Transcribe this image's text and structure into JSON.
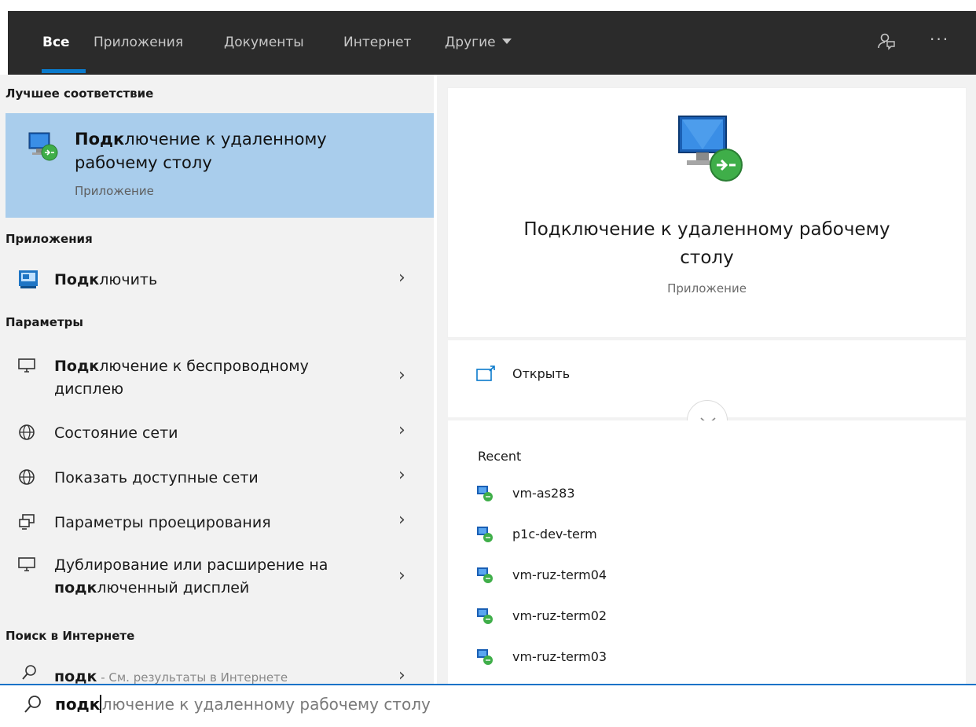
{
  "tabs": {
    "all": "Все",
    "apps": "Приложения",
    "docs": "Документы",
    "web": "Интернет",
    "other": "Другие"
  },
  "left": {
    "best_match_title": "Лучшее соответствие",
    "best_match": {
      "title_bold": "Подк",
      "title_rest_line1": "лючение к удаленному",
      "title_line2": "рабочему столу",
      "subtitle": "Приложение"
    },
    "apps_title": "Приложения",
    "apps": [
      {
        "bold": "Подк",
        "rest": "лючить"
      }
    ],
    "settings_title": "Параметры",
    "settings": [
      {
        "bold": "Подк",
        "rest": "лючение к беспроводному",
        "line2": "дисплею"
      },
      {
        "label": "Состояние сети"
      },
      {
        "label": "Показать доступные сети"
      },
      {
        "label": "Параметры проецирования"
      },
      {
        "line1": "Дублирование или расширение на",
        "bold2": "подк",
        "rest2": "люченный дисплей"
      }
    ],
    "web_title": "Поиск в Интернете",
    "web": {
      "bold": "подк",
      "rest": " - См. результаты в Интернете"
    }
  },
  "right": {
    "app_title_line1": "Подключение к удаленному рабочему",
    "app_title_line2": "столу",
    "app_subtitle": "Приложение",
    "open_label": "Открыть",
    "recent_title": "Recent",
    "recent": [
      "vm-as283",
      "p1c-dev-term",
      "vm-ruz-term04",
      "vm-ruz-term02",
      "vm-ruz-term03"
    ]
  },
  "search": {
    "typed": "подк",
    "suggestion": "лючение к удаленному рабочему столу"
  },
  "colors": {
    "tabbar_bg": "#2b2b2b",
    "accent": "#0a7acc",
    "selected_bg": "#a9cdec",
    "panel_bg": "#f2f2f2"
  }
}
